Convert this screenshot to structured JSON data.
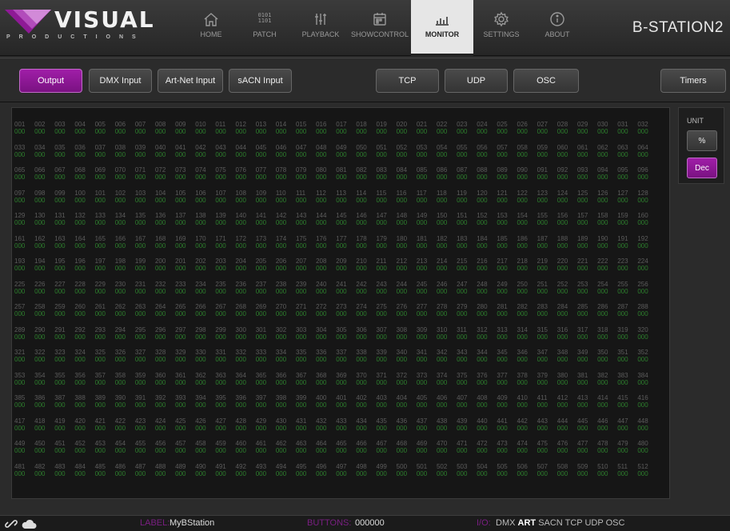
{
  "header": {
    "logo_word": "VISUAL",
    "logo_sub": "PRODUCTIONS",
    "device_name": "B-STATION2",
    "nav": [
      {
        "label": "HOME",
        "icon": "home-icon"
      },
      {
        "label": "PATCH",
        "icon": "binary-icon",
        "binary": [
          "0101",
          "1101"
        ]
      },
      {
        "label": "PLAYBACK",
        "icon": "sliders-icon"
      },
      {
        "label": "SHOWCONTROL",
        "icon": "calendar-icon"
      },
      {
        "label": "MONITOR",
        "icon": "monitor-icon"
      },
      {
        "label": "SETTINGS",
        "icon": "gear-icon"
      },
      {
        "label": "ABOUT",
        "icon": "info-icon"
      }
    ],
    "active_nav": "MONITOR"
  },
  "toolbar": {
    "output": "Output",
    "dmx_input": "DMX Input",
    "artnet_input": "Art-Net Input",
    "sacn_input": "sACN Input",
    "tcp": "TCP",
    "udp": "UDP",
    "osc": "OSC",
    "timers": "Timers",
    "active": "Output"
  },
  "monitor": {
    "channel_count": 512,
    "default_value": "000"
  },
  "unit": {
    "label": "UNIT",
    "percent": "%",
    "dec": "Dec",
    "active": "Dec"
  },
  "status": {
    "label_key": "LABEL:",
    "label_value": "MyBStation",
    "buttons_key": "BUTTONS:",
    "buttons_value": "000000",
    "io_key": "I/O:",
    "proto_dmx": "DMX",
    "proto_art": "ART",
    "proto_sacn": "SACN",
    "proto_tcp": "TCP",
    "proto_udp": "UDP",
    "proto_osc": "OSC"
  },
  "colors": {
    "accent": "#8e1a96",
    "value_green": "#2d7f2d",
    "channel_grey": "#5c5c5c"
  }
}
